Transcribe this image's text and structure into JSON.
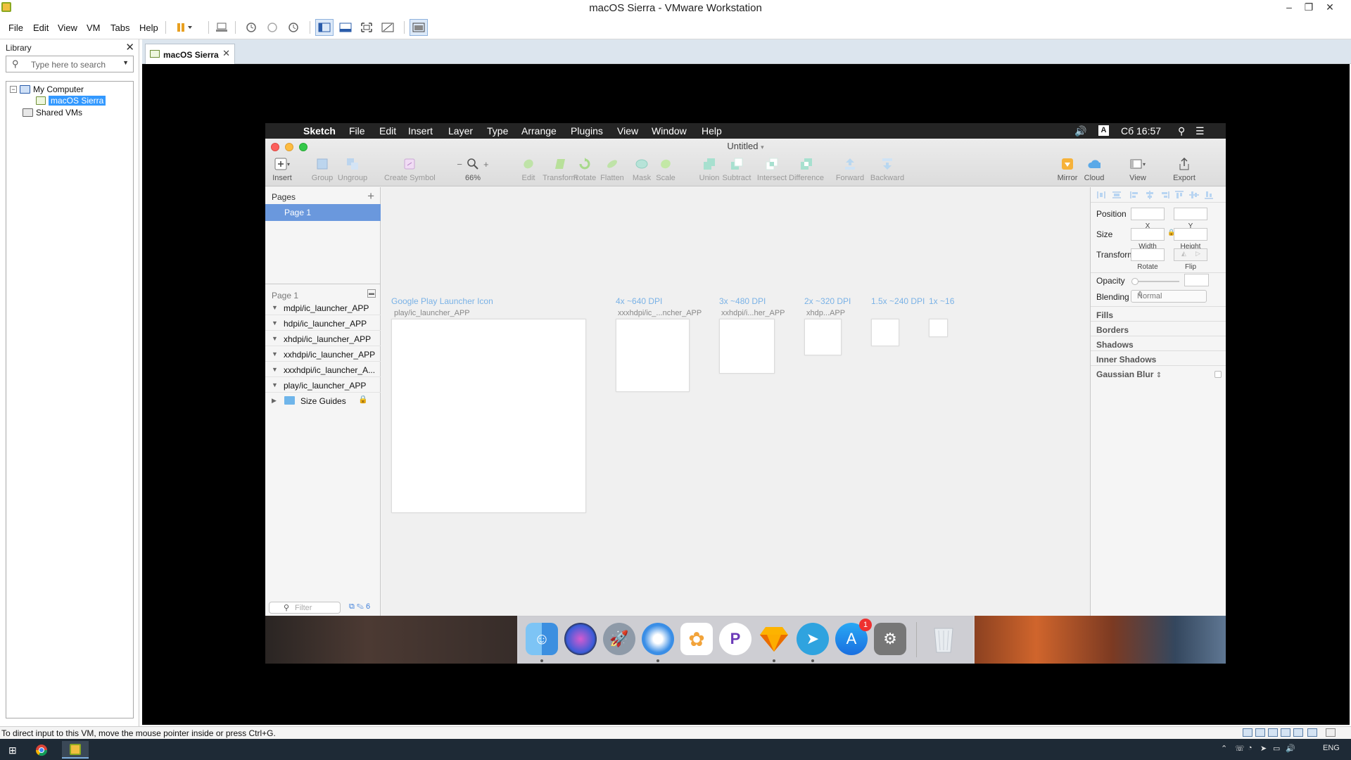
{
  "window": {
    "title": "macOS Sierra - VMware Workstation"
  },
  "menubar": {
    "items": [
      "File",
      "Edit",
      "View",
      "VM",
      "Tabs",
      "Help"
    ]
  },
  "library": {
    "title": "Library",
    "search_placeholder": "Type here to search",
    "tree": [
      {
        "label": "My Computer",
        "expanded": true
      },
      {
        "label": "macOS Sierra",
        "selected": true
      },
      {
        "label": "Shared VMs"
      }
    ]
  },
  "tabs": [
    {
      "label": "macOS Sierra"
    }
  ],
  "status": {
    "message": "To direct input to this VM, move the mouse pointer inside or press Ctrl+G."
  },
  "taskbar": {
    "language": "ENG"
  },
  "mac_menubar": {
    "app": "Sketch",
    "items": [
      "File",
      "Edit",
      "Insert",
      "Layer",
      "Type",
      "Arrange",
      "Plugins",
      "View",
      "Window",
      "Help"
    ],
    "input_source": "A",
    "clock": "Сб 16:57"
  },
  "sketch": {
    "doc_title": "Untitled",
    "toolbar": {
      "insert": "Insert",
      "group": "Group",
      "ungroup": "Ungroup",
      "create_symbol": "Create Symbol",
      "zoom_minus": "−",
      "zoom_plus": "+",
      "zoom": "66%",
      "edit": "Edit",
      "transform": "Transform",
      "rotate": "Rotate",
      "flatten": "Flatten",
      "mask": "Mask",
      "scale": "Scale",
      "union": "Union",
      "subtract": "Subtract",
      "intersect": "Intersect",
      "difference": "Difference",
      "forward": "Forward",
      "backward": "Backward",
      "mirror": "Mirror",
      "cloud": "Cloud",
      "view": "View",
      "export": "Export"
    },
    "pages": {
      "title": "Pages",
      "items": [
        "Page 1"
      ]
    },
    "layers": {
      "page_title": "Page 1",
      "items": [
        "mdpi/ic_launcher_APP",
        "hdpi/ic_launcher_APP",
        "xhdpi/ic_launcher_APP",
        "xxhdpi/ic_launcher_APP",
        "xxxhdpi/ic_launcher_A...",
        "play/ic_launcher_APP",
        "Size Guides"
      ],
      "filter_placeholder": "Filter",
      "count": "6"
    },
    "artboards": [
      {
        "title": "Google Play Launcher Icon",
        "name": "play/ic_launcher_APP"
      },
      {
        "title": "4x ~640 DPI",
        "name": "xxxhdpi/ic_...ncher_APP"
      },
      {
        "title": "3x ~480 DPI",
        "name": "xxhdpi/i...her_APP"
      },
      {
        "title": "2x ~320 DPI",
        "name": "xhdp...APP"
      },
      {
        "title": "1.5x ~240 DPI",
        "name": ""
      },
      {
        "title": "1x ~16",
        "name": ""
      }
    ],
    "inspector": {
      "position": "Position",
      "x": "X",
      "y": "Y",
      "size": "Size",
      "width": "Width",
      "height": "Height",
      "transform": "Transform",
      "rotate": "Rotate",
      "flip": "Flip",
      "opacity": "Opacity",
      "blending": "Blending",
      "blending_value": "Normal",
      "sections": [
        "Fills",
        "Borders",
        "Shadows",
        "Inner Shadows",
        "Gaussian Blur"
      ]
    }
  },
  "dock": {
    "apps": [
      "finder-icon",
      "siri-icon",
      "launchpad-icon",
      "safari-icon",
      "photos-icon",
      "pockity-icon",
      "sketch-icon",
      "telegram-icon",
      "app-store-icon",
      "system-preferences-icon",
      "trash-icon"
    ],
    "app_store_badge": "1"
  }
}
